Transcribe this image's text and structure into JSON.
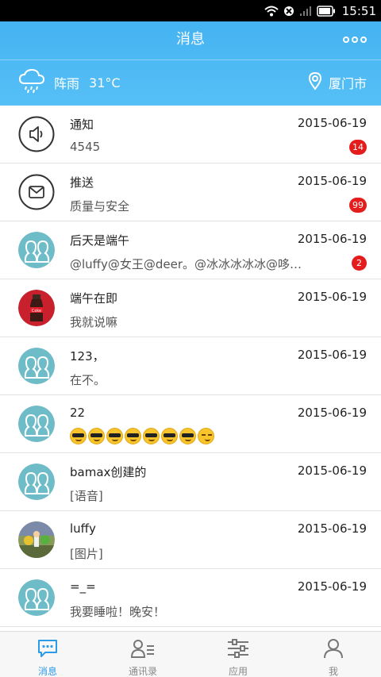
{
  "status_bar": {
    "time": "15:51"
  },
  "header": {
    "title": "消息",
    "weather": {
      "condition": "阵雨",
      "temperature": "31°C",
      "icon": "rain-cloud-icon"
    },
    "location": {
      "city": "厦门市",
      "icon": "location-pin-icon"
    },
    "more_icon": "more-icon"
  },
  "messages": [
    {
      "name": "通知",
      "date": "2015-06-19",
      "preview": "4545",
      "badge": "14",
      "avatar": "speaker"
    },
    {
      "name": "推送",
      "date": "2015-06-19",
      "preview": "质量与安全",
      "badge": "99",
      "avatar": "mail"
    },
    {
      "name": "后天是端午",
      "date": "2015-06-19",
      "preview": "@luffy@女王@deer。@冰冰冰冰冰@哆…",
      "badge": "2",
      "avatar": "group"
    },
    {
      "name": "端午在即",
      "date": "2015-06-19",
      "preview": "我就说嘛",
      "badge": "",
      "avatar": "photo-cola"
    },
    {
      "name": "123，",
      "date": "2015-06-19",
      "preview": "在不。",
      "badge": "",
      "avatar": "group"
    },
    {
      "name": "22",
      "date": "2015-06-19",
      "preview": "",
      "badge": "",
      "avatar": "group"
    },
    {
      "name": "bamax创建的",
      "date": "2015-06-19",
      "preview": "[语音]",
      "badge": "",
      "avatar": "group"
    },
    {
      "name": "luffy",
      "date": "2015-06-19",
      "preview": "[图片]",
      "badge": "",
      "avatar": "photo-luffy"
    },
    {
      "name": "=_=",
      "date": "2015-06-19",
      "preview": "我要睡啦！晚安！",
      "badge": "",
      "avatar": "group"
    }
  ],
  "tabs": [
    {
      "label": "消息",
      "icon": "chat-icon",
      "active": true
    },
    {
      "label": "通讯录",
      "icon": "contacts-icon",
      "active": false
    },
    {
      "label": "应用",
      "icon": "sliders-icon",
      "active": false
    },
    {
      "label": "我",
      "icon": "person-icon",
      "active": false
    }
  ],
  "colors": {
    "header": "#45b3f2",
    "accent": "#2b9be8",
    "badge": "#e41c1c",
    "avatar_group": "#6fbcc9"
  }
}
